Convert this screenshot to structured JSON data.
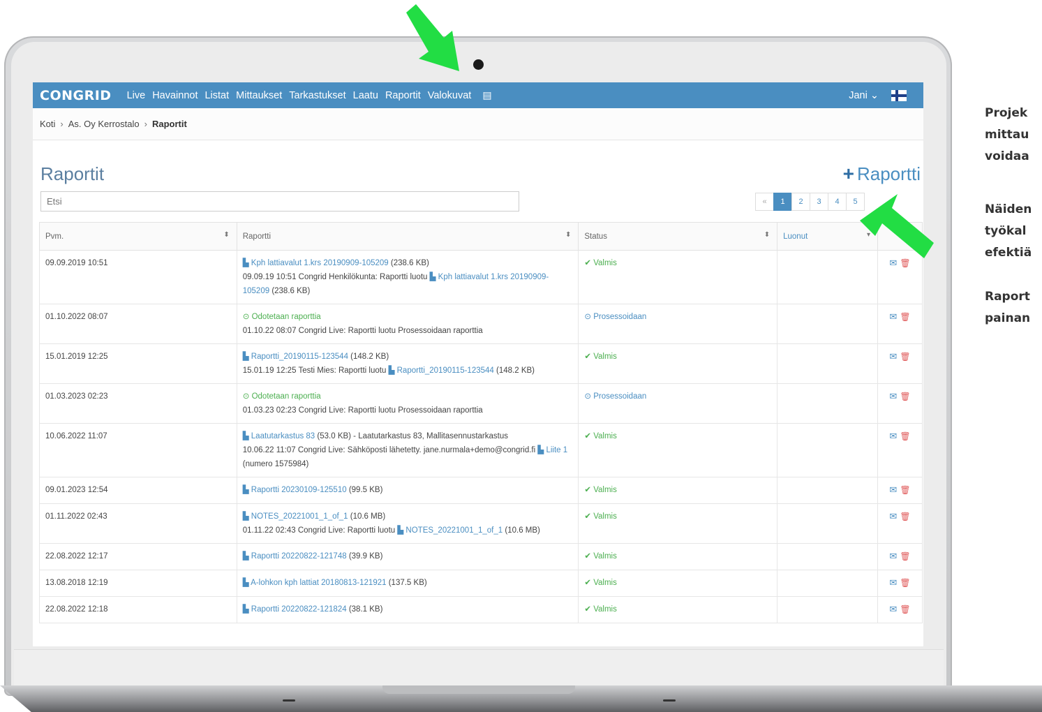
{
  "app": {
    "logo": "CONGRID",
    "nav": [
      "Live",
      "Havainnot",
      "Listat",
      "Mittaukset",
      "Tarkastukset",
      "Laatu",
      "Raportit",
      "Valokuvat"
    ],
    "user": "Jani",
    "colors": {
      "brand": "#4a8ec1",
      "ok": "#4caf50",
      "delete": "#e05b5b",
      "annotation_arrow": "#22dd44"
    }
  },
  "breadcrumb": {
    "home": "Koti",
    "project": "As. Oy Kerrostalo",
    "current": "Raportit"
  },
  "page": {
    "title": "Raportit",
    "add_label": "Raportti",
    "search_placeholder": "Etsi",
    "pagination": {
      "prev": "«",
      "pages": [
        "1",
        "2",
        "3",
        "4",
        "5"
      ],
      "active": "1"
    }
  },
  "table": {
    "headers": [
      "Pvm.",
      "Raportti",
      "Status",
      "Luonut"
    ],
    "rows": [
      {
        "date": "09.09.2019 10:51",
        "report": "Kph lattiavalut 1.krs 20190909-105209",
        "size": "(238.6 KB)",
        "log": "09.09.19 10:51 Congrid Henkilökunta: Raportti luotu",
        "log_link": "Kph lattiavalut 1.krs 20190909-105209",
        "log_tail": "(238.6 KB)",
        "status": "Valmis"
      },
      {
        "date": "01.10.2022 08:07",
        "report": "Odotetaan raporttia",
        "size": "",
        "log": "01.10.22 08:07 Congrid Live: Raportti luotu Prosessoidaan raporttia",
        "log_link": "",
        "log_tail": "",
        "status": "Prosessoidaan"
      },
      {
        "date": "15.01.2019 12:25",
        "report": "Raportti_20190115-123544",
        "size": "(148.2 KB)",
        "log": "15.01.19 12:25 Testi Mies: Raportti luotu",
        "log_link": "Raportti_20190115-123544",
        "log_tail": "(148.2 KB)",
        "status": "Valmis"
      },
      {
        "date": "01.03.2023 02:23",
        "report": "Odotetaan raporttia",
        "size": "",
        "log": "01.03.23 02:23 Congrid Live: Raportti luotu Prosessoidaan raporttia",
        "log_link": "",
        "log_tail": "",
        "status": "Prosessoidaan"
      },
      {
        "date": "10.06.2022 11:07",
        "report": "Laatutarkastus 83",
        "size": "(53.0 KB) - Laatutarkastus 83, Mallitasennustarkastus",
        "log": "10.06.22 11:07 Congrid Live: Sähköposti lähetetty. jane.nurmala+demo@congrid.fi",
        "log_link": "Liite 1",
        "log_tail": "(numero 1575984)",
        "status": "Valmis"
      },
      {
        "date": "09.01.2023 12:54",
        "report": "Raportti 20230109-125510",
        "size": "(99.5 KB)",
        "log": "",
        "log_link": "",
        "log_tail": "",
        "status": "Valmis"
      },
      {
        "date": "01.11.2022 02:43",
        "report": "NOTES_20221001_1_of_1",
        "size": "(10.6 MB)",
        "log": "01.11.22 02:43 Congrid Live: Raportti luotu",
        "log_link": "NOTES_20221001_1_of_1",
        "log_tail": "(10.6 MB)",
        "status": "Valmis"
      },
      {
        "date": "22.08.2022 12:17",
        "report": "Raportti 20220822-121748",
        "size": "(39.9 KB)",
        "log": "",
        "log_link": "",
        "log_tail": "",
        "status": "Valmis"
      },
      {
        "date": "13.08.2018 12:19",
        "report": "A-lohkon kph lattiat 20180813-121921",
        "size": "(137.5 KB)",
        "log": "",
        "log_link": "",
        "log_tail": "",
        "status": "Valmis"
      },
      {
        "date": "22.08.2022 12:18",
        "report": "Raportti 20220822-121824",
        "size": "(38.1 KB)",
        "log": "",
        "log_link": "",
        "log_tail": "",
        "status": "Valmis"
      }
    ]
  },
  "side_text": [
    "Projek",
    "mittau",
    "voidaa",
    "Näiden",
    "työkal",
    "efektiä",
    "Raport",
    "painan"
  ]
}
